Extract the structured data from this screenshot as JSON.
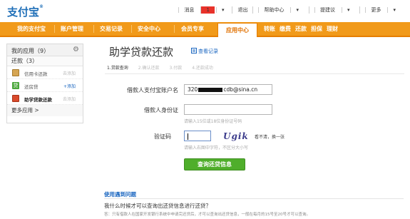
{
  "header": {
    "logo": "支付宝",
    "logo_reg": "®",
    "message_label": "消息",
    "message_count": "1",
    "links": [
      "退出",
      "帮助中心",
      "提建议",
      "更多"
    ]
  },
  "nav": {
    "items": [
      "我的支付宝",
      "账户管理",
      "交易记录",
      "安全中心",
      "会员专享",
      "应用中心"
    ],
    "active": "应用中心",
    "sub_items": [
      "转账",
      "缴费",
      "还款",
      "担保",
      "理财"
    ]
  },
  "sidebar": {
    "title": "我的应用（9）",
    "section": "还款（3）",
    "items": [
      {
        "label": "信用卡还款",
        "action": "去添加"
      },
      {
        "label": "还房贷",
        "action": "+添加"
      },
      {
        "label": "助学贷款还款",
        "action": "去添加"
      }
    ],
    "more": "更多应用 >"
  },
  "main": {
    "title": "助学贷款还款",
    "records_link": "查看记录",
    "steps": [
      "1.贷款查询",
      "2.确认还款",
      "3.付款",
      "4.还款成功"
    ],
    "fields": {
      "account_label": "借款人支付宝账户名",
      "account_value_prefix": "320",
      "account_value_suffix": "cdb@sina.cn",
      "id_label": "借款人身份证",
      "id_hint": "请输入15位或18位身份证号码",
      "captcha_label": "验证码",
      "captcha_text": "Ugik",
      "captcha_refresh": "看不清，换一张",
      "captcha_hint": "请输入右图中字符，不区分大小写"
    },
    "submit": "查询还贷信息",
    "faq": {
      "heading": "使用遇到问题",
      "question": "我什么时候才可以查询出还贷信息进行还贷？",
      "answer": "答：只有借款人在国家开发银行系统中申请完还贷后，才可以查询出还贷信息，一般在每月的15号至20号才可以查询。"
    }
  },
  "colors": {
    "nav_orange": "#f19a1a",
    "link_blue": "#1a66c0",
    "button_green": "#4fae2b",
    "badge_red": "#e8322a"
  }
}
